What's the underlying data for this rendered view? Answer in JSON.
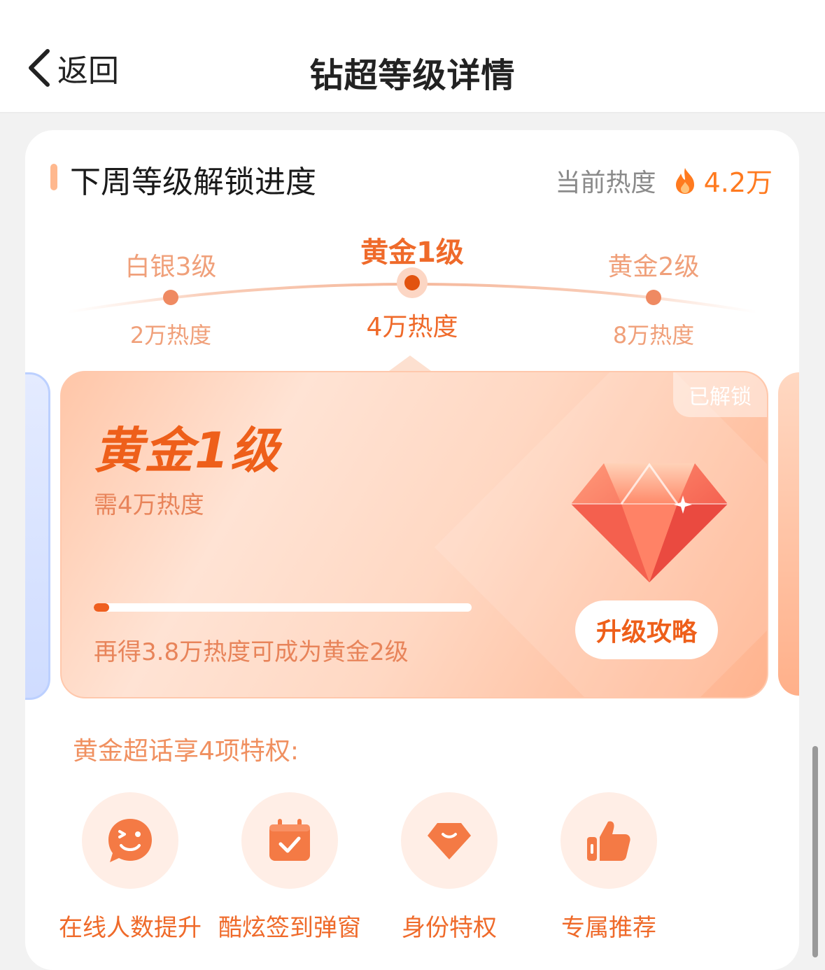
{
  "nav": {
    "back_label": "返回",
    "title": "钻超等级详情"
  },
  "section": {
    "title": "下周等级解锁进度",
    "current_heat_label": "当前热度",
    "current_heat_value": "4.2万"
  },
  "timeline": {
    "levels": [
      {
        "name": "白银3级",
        "heat": "2万热度",
        "active": false
      },
      {
        "name": "黄金1级",
        "heat": "4万热度",
        "active": true
      },
      {
        "name": "黄金2级",
        "heat": "8万热度",
        "active": false
      }
    ]
  },
  "card": {
    "badge": "已解锁",
    "title": "黄金1级",
    "requirement": "需4万热度",
    "progress": 0.04,
    "hint": "再得3.8万热度可成为黄金2级",
    "upgrade_button": "升级攻略"
  },
  "privileges": {
    "title": "黄金超话享4项特权:",
    "items": [
      {
        "label": "在线人数提升",
        "icon": "smiley-chat-icon"
      },
      {
        "label": "酷炫签到弹窗",
        "icon": "calendar-check-icon"
      },
      {
        "label": "身份特权",
        "icon": "diamond-icon"
      },
      {
        "label": "专属推荐",
        "icon": "thumbs-up-icon"
      }
    ]
  },
  "colors": {
    "accent": "#ef6a2a",
    "accent_light": "#f0a07a",
    "heat": "#ff7a1f"
  }
}
